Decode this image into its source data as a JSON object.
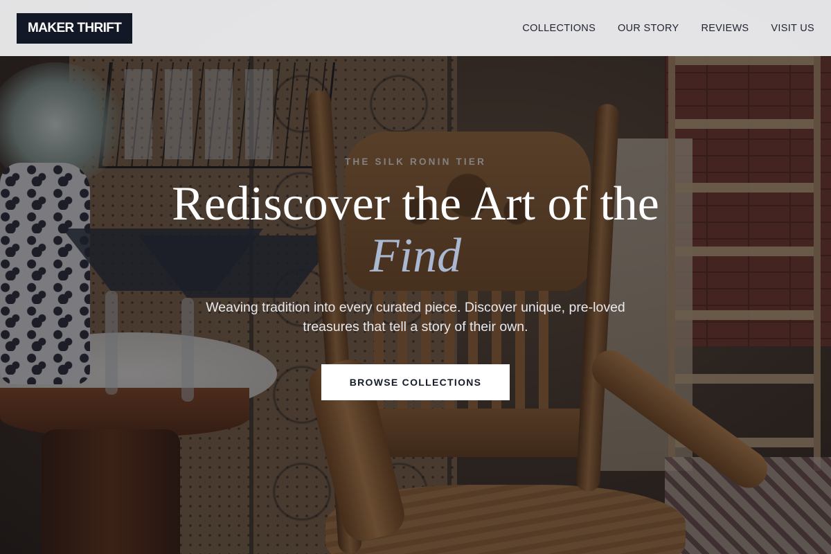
{
  "nav": {
    "logo": "MAKER THRIFT",
    "links": [
      {
        "label": "COLLECTIONS"
      },
      {
        "label": "OUR STORY"
      },
      {
        "label": "REVIEWS"
      },
      {
        "label": "VISIT US"
      }
    ]
  },
  "hero": {
    "eyebrow": "THE SILK RONIN TIER",
    "headline": "Rediscover the Art of the",
    "headline_accent": "Find",
    "subtitle": "Weaving tradition into every curated piece. Discover unique, pre-loved treasures that tell a story of their own.",
    "cta_label": "BROWSE COLLECTIONS"
  },
  "colors": {
    "logo_bg": "#121826",
    "navbar_bg": "#f2f2f4",
    "accent_text": "#aab8d2",
    "cta_bg": "#ffffff",
    "cta_text": "#141a26"
  }
}
